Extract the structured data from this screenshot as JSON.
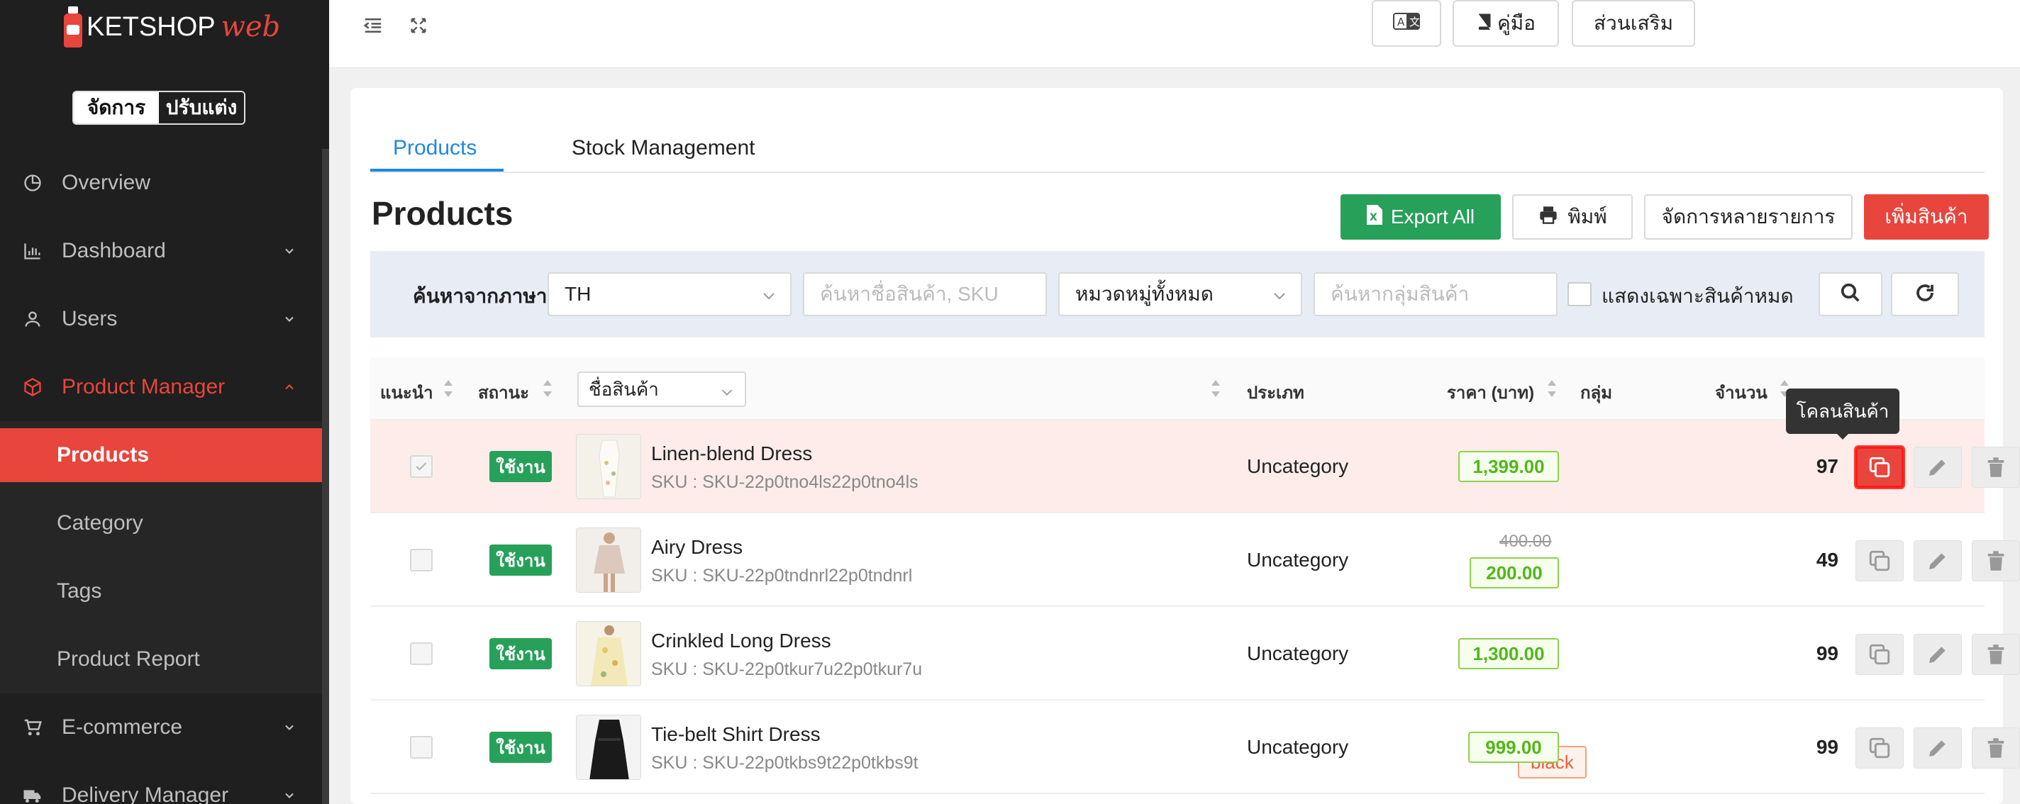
{
  "brand": {
    "name": "KETSHOP",
    "suffix": "web"
  },
  "mode_toggle": {
    "manage": "จัดการ",
    "customize": "ปรับแต่ง"
  },
  "sidebar": {
    "items": [
      {
        "label": "Overview"
      },
      {
        "label": "Dashboard"
      },
      {
        "label": "Users"
      },
      {
        "label": "Product Manager"
      },
      {
        "label": "E-commerce"
      },
      {
        "label": "Delivery Manager"
      }
    ],
    "submenu": [
      {
        "label": "Products"
      },
      {
        "label": "Category"
      },
      {
        "label": "Tags"
      },
      {
        "label": "Product Report"
      }
    ]
  },
  "topbar": {
    "manual_label": "คู่มือ",
    "addons_label": "ส่วนเสริม"
  },
  "tabs": [
    {
      "label": "Products"
    },
    {
      "label": "Stock Management"
    }
  ],
  "page": {
    "title": "Products",
    "export_label": "Export All",
    "print_label": "พิมพ์",
    "bulk_label": "จัดการหลายรายการ",
    "add_label": "เพิ่มสินค้า"
  },
  "filters": {
    "language_label": "ค้นหาจากภาษา",
    "language_value": "TH",
    "search_placeholder": "ค้นหาชื่อสินค้า, SKU",
    "category_value": "หมวดหมู่ทั้งหมด",
    "group_placeholder": "ค้นหากลุ่มสินค้า",
    "out_of_stock_label": "แสดงเฉพาะสินค้าหมด"
  },
  "table": {
    "headers": {
      "recommend": "แนะนำ",
      "status": "สถานะ",
      "name_select": "ชื่อสินค้า",
      "type": "ประเภท",
      "price": "ราคา (บาท)",
      "group": "กลุ่ม",
      "qty": "จำนวน"
    },
    "rows": [
      {
        "name": "Linen-blend Dress",
        "sku": "SKU : SKU-22p0tno4ls22p0tno4ls",
        "status": "ใช้งาน",
        "type": "Uncategory",
        "price": "1,399.00",
        "old_price": "",
        "tag": "",
        "qty": "97",
        "recommended": true
      },
      {
        "name": "Airy Dress",
        "sku": "SKU : SKU-22p0tndnrl22p0tndnrl",
        "status": "ใช้งาน",
        "type": "Uncategory",
        "price": "200.00",
        "old_price": "400.00",
        "tag": "",
        "qty": "49",
        "recommended": false
      },
      {
        "name": "Crinkled Long Dress",
        "sku": "SKU : SKU-22p0tkur7u22p0tkur7u",
        "status": "ใช้งาน",
        "type": "Uncategory",
        "price": "1,300.00",
        "old_price": "",
        "tag": "",
        "qty": "99",
        "recommended": false
      },
      {
        "name": "Tie-belt Shirt Dress",
        "sku": "SKU : SKU-22p0tkbs9t22p0tkbs9t",
        "status": "ใช้งาน",
        "type": "Uncategory",
        "price": "999.00",
        "old_price": "",
        "tag": "black",
        "qty": "99",
        "recommended": false
      }
    ]
  },
  "tooltip": {
    "clone": "โคลนสินค้า"
  },
  "colors": {
    "brand_red": "#e8453c",
    "green": "#27a05a",
    "blue": "#1e88e5",
    "sidebar_bg": "#1f1f1f"
  }
}
